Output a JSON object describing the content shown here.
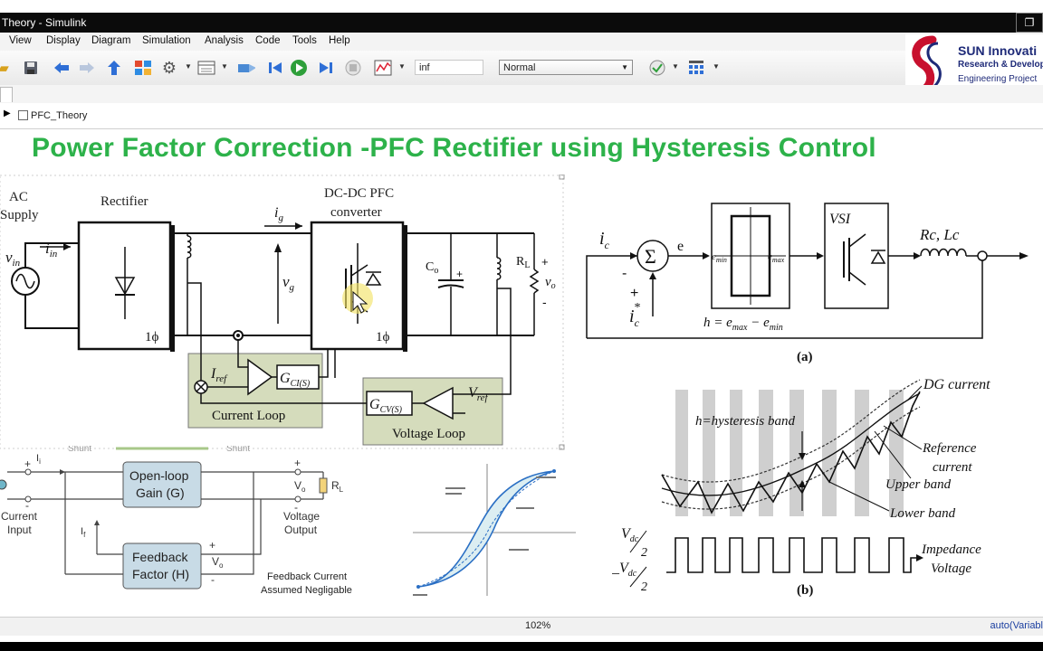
{
  "window": {
    "title": "Theory - Simulink",
    "restore_symbol": "❐"
  },
  "menu": [
    "View",
    "Display",
    "Diagram",
    "Simulation",
    "Analysis",
    "Code",
    "Tools",
    "Help"
  ],
  "toolbar": {
    "icons": [
      "open-folder-icon",
      "save-icon",
      "back-arrow-icon",
      "forward-arrow-icon",
      "up-arrow-icon",
      "library-browser-icon",
      "model-settings-icon",
      "model-explorer-icon",
      "build-icon",
      "step-back-icon",
      "run-icon",
      "step-forward-icon",
      "stop-icon",
      "scope-icon",
      "check-icon",
      "grid-icon"
    ],
    "stop_time": "inf",
    "sim_mode": "Normal"
  },
  "breadcrumb": {
    "model": "PFC_Theory"
  },
  "page_title": "Power Factor Correction -PFC Rectifier using Hysteresis Control",
  "logo": {
    "line1": "SUN Innovati",
    "line2": "Research & Develop",
    "line3": "Engineering Project",
    "brand_color": "#c8102e"
  },
  "circuit": {
    "ac_supply_1": "AC",
    "ac_supply_2": "Supply",
    "rectifier": "Rectifier",
    "dcdc_1": "DC-DC PFC",
    "dcdc_2": "converter",
    "vin": "v",
    "vin_sub": "in",
    "iin": "i",
    "iin_sub": "in",
    "ig": "i",
    "ig_sub": "g",
    "vg": "v",
    "vg_sub": "g",
    "phase1": "1ϕ",
    "phase2": "1ϕ",
    "co": "C",
    "co_sub": "o",
    "rl": "R",
    "rl_sub": "L",
    "vo": "v",
    "vo_sub": "o",
    "plus": "+",
    "minus": "-",
    "iref": "I",
    "iref_sub": "ref",
    "gci": "G",
    "gci_sub": "CI(S)",
    "gcv": "G",
    "gcv_sub": "CV(S)",
    "vref": "V",
    "vref_sub": "ref",
    "current_loop": "Current Loop",
    "voltage_loop": "Voltage Loop"
  },
  "hysteresis_block": {
    "ic": "i",
    "ic_sub": "c",
    "ic_star": "i",
    "ic_star_sub": "c",
    "ic_star_sup": "*",
    "minus": "-",
    "plus": "+",
    "sigma": "Σ",
    "e": "e",
    "emin": "e",
    "emin_sub": "min",
    "emax": "e",
    "emax_sub": "max",
    "h_eq": "h = e",
    "h_eq_max": "max",
    "h_eq_mid": " − e",
    "h_eq_min": "min",
    "vsi": "VSI",
    "rclc": "Rc, Lc",
    "label_a": "(a)"
  },
  "waveform": {
    "dg_current": "DG current",
    "h_band": "h=hysteresis band",
    "reference_1": "Reference",
    "reference_2": "current",
    "upper_band": "Upper band",
    "lower_band": "Lower band",
    "vdc_plus": "V",
    "vdc_sub": "dc",
    "vdc_den": "2",
    "vdc_minus": "_V",
    "impedance_1": "Impedance",
    "impedance_2": "Voltage",
    "label_b": "(b)"
  },
  "feedback": {
    "shunt_1": "Shunt",
    "shunt_2": "Shunt",
    "i1": "I",
    "i1_sub": "i",
    "if": "I",
    "if_sub": "f",
    "open_loop_1": "Open-loop",
    "open_loop_2": "Gain (G)",
    "feedback_1": "Feedback",
    "feedback_2": "Factor (H)",
    "vo": "V",
    "vo_sub": "o",
    "vo2": "V",
    "vo2_sub": "o",
    "rl": "R",
    "rl_sub": "L",
    "current_input_1": "Current",
    "current_input_2": "Input",
    "voltage_output_1": "Voltage",
    "voltage_output_2": "Output",
    "fb_note_1": "Feedback Current",
    "fb_note_2": "Assumed Negligable",
    "plus": "+",
    "minus": "-"
  },
  "status": {
    "zoom": "102%",
    "solver": "auto(Variabl"
  }
}
